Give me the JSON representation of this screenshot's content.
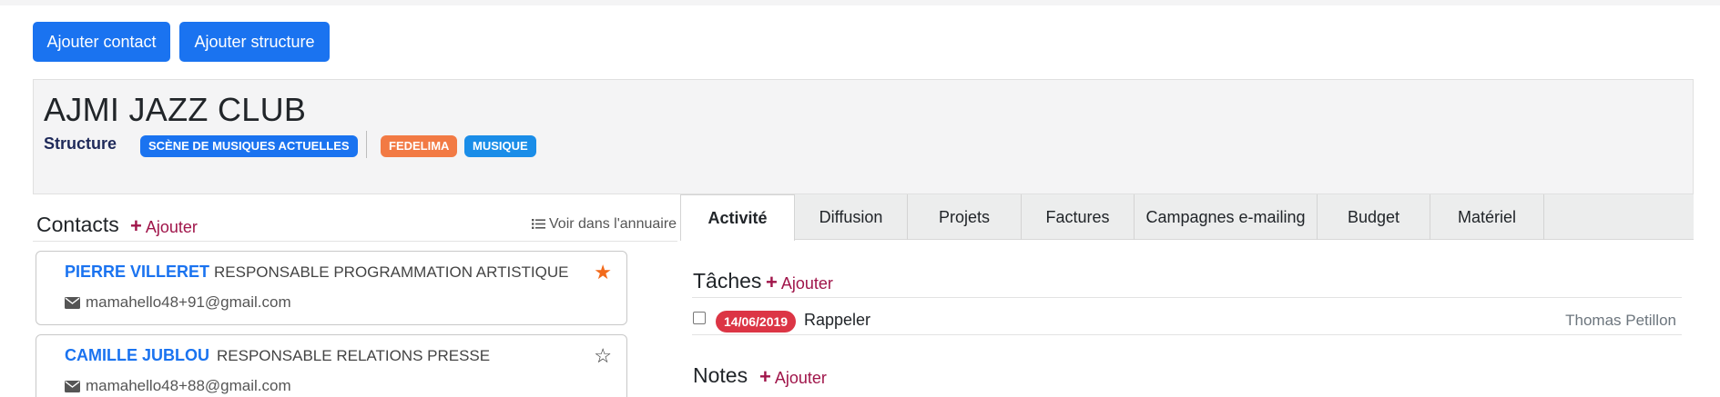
{
  "toolbar": {
    "add_contact": "Ajouter contact",
    "add_structure": "Ajouter structure"
  },
  "org": {
    "name": "AJMI JAZZ CLUB",
    "type": "Structure",
    "tags": [
      {
        "label": "SCÈNE DE MUSIQUES ACTUELLES",
        "color": "#1a73f0"
      },
      {
        "label": "FEDELIMA",
        "color": "#f27a44"
      },
      {
        "label": "MUSIQUE",
        "color": "#1a8de8"
      }
    ]
  },
  "contacts": {
    "title": "Contacts",
    "add_label": "Ajouter",
    "directory_link": "Voir dans l'annuaire",
    "items": [
      {
        "name": "PIERRE VILLERET",
        "role": "RESPONSABLE PROGRAMMATION ARTISTIQUE",
        "email": "mamahello48+91@gmail.com",
        "starred": true,
        "star_icon": "star-filled-icon"
      },
      {
        "name": "CAMILLE JUBLOU",
        "role": "RESPONSABLE RELATIONS PRESSE",
        "email": "mamahello48+88@gmail.com",
        "starred": false,
        "star_icon": "star-outline-icon"
      }
    ]
  },
  "tabs": [
    {
      "label": "Activité",
      "active": true
    },
    {
      "label": "Diffusion",
      "active": false
    },
    {
      "label": "Projets",
      "active": false
    },
    {
      "label": "Factures",
      "active": false
    },
    {
      "label": "Campagnes e-mailing",
      "active": false
    },
    {
      "label": "Budget",
      "active": false
    },
    {
      "label": "Matériel",
      "active": false
    }
  ],
  "tasks": {
    "title": "Tâches",
    "add_label": "Ajouter",
    "items": [
      {
        "date": "14/06/2019",
        "text": "Rappeler",
        "owner": "Thomas Petillon",
        "checked": false
      }
    ]
  },
  "notes": {
    "title": "Notes",
    "add_label": "Ajouter"
  },
  "colors": {
    "primary": "#1a73f0",
    "accent_link": "#a0154a",
    "danger": "#dc3545",
    "star": "#f26a1b"
  }
}
